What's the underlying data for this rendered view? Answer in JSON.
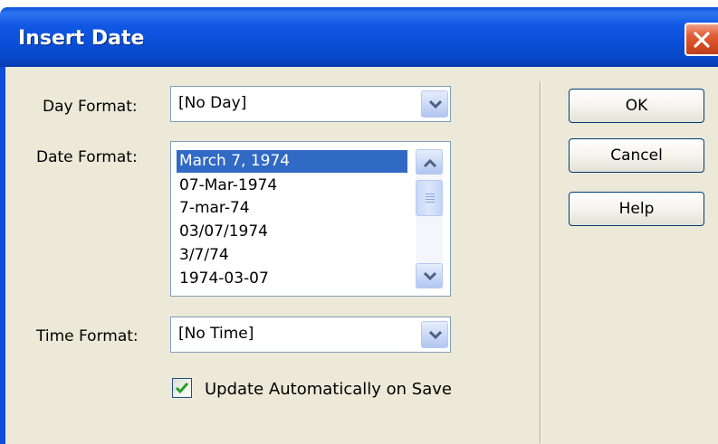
{
  "dialog": {
    "title": "Insert Date"
  },
  "day_format": {
    "label": "Day Format:",
    "selected": "[No Day]"
  },
  "date_format": {
    "label": "Date Format:",
    "items": [
      {
        "text": "March 7, 1974",
        "selected": true
      },
      {
        "text": "07-Mar-1974",
        "selected": false
      },
      {
        "text": "7-mar-74",
        "selected": false
      },
      {
        "text": "03/07/1974",
        "selected": false
      },
      {
        "text": "3/7/74",
        "selected": false
      },
      {
        "text": "1974-03-07",
        "selected": false
      }
    ]
  },
  "time_format": {
    "label": "Time Format:",
    "selected": "[No Time]"
  },
  "update_checkbox": {
    "label": "Update Automatically on Save",
    "checked": true
  },
  "buttons": {
    "ok": "OK",
    "cancel": "Cancel",
    "help": "Help"
  },
  "colors": {
    "titlebar": "#0a4fd8",
    "selection": "#316ac5",
    "close": "#d24a24",
    "check": "#21a121"
  },
  "icons": [
    "close-icon",
    "chevron-down-icon",
    "chevron-up-icon",
    "checkmark-icon"
  ]
}
